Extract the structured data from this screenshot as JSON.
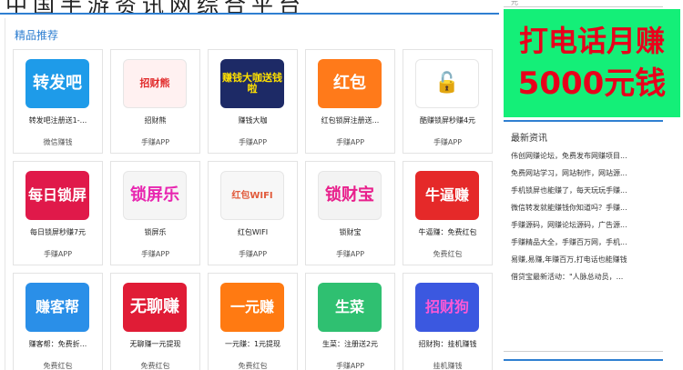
{
  "header": {
    "ghost_title": "中国手游资讯网综合平台"
  },
  "section": {
    "title": "精品推荐"
  },
  "apps": [
    {
      "name": "转发吧注册送1-...",
      "category": "微信赚钱",
      "thumb_text": "转发吧",
      "bg": "#1e9be9",
      "fg": "#ffffff",
      "fs": 18
    },
    {
      "name": "招财熊",
      "category": "手赚APP",
      "thumb_text": "招财熊",
      "bg": "#fff1f1",
      "fg": "#e12c2c",
      "fs": 11
    },
    {
      "name": "赚钱大咖",
      "category": "手赚APP",
      "thumb_text": "赚钱大咖送钱啦",
      "bg": "#1d2a66",
      "fg": "#ffe000",
      "fs": 11
    },
    {
      "name": "红包锁屏注册送...",
      "category": "手赚APP",
      "thumb_text": "红包",
      "bg": "#ff7a1a",
      "fg": "#ffffff",
      "fs": 18
    },
    {
      "name": "酷赚锁屏秒赚4元",
      "category": "手赚APP",
      "thumb_text": "🔓",
      "bg": "#ffffff",
      "fg": "#3ca8e8",
      "fs": 22
    },
    {
      "name": "每日锁屏秒赚7元",
      "category": "手赚APP",
      "thumb_text": "每日锁屏",
      "bg": "#e0194a",
      "fg": "#ffffff",
      "fs": 16
    },
    {
      "name": "锁屏乐",
      "category": "手赚APP",
      "thumb_text": "锁屏乐",
      "bg": "#f5f5f5",
      "fg": "#e826b0",
      "fs": 18
    },
    {
      "name": "红包WIFI",
      "category": "手赚APP",
      "thumb_text": "红包WIFI",
      "bg": "#f7f7f7",
      "fg": "#e15a3a",
      "fs": 10
    },
    {
      "name": "锁财宝",
      "category": "手赚APP",
      "thumb_text": "锁财宝",
      "bg": "#f3f3f3",
      "fg": "#e8208c",
      "fs": 18
    },
    {
      "name": "牛逼赚：免费红包",
      "category": "免费红包",
      "thumb_text": "牛逼赚",
      "bg": "#e52929",
      "fg": "#ffffff",
      "fs": 16
    },
    {
      "name": "赚客帮：免费折...",
      "category": "免费红包",
      "thumb_text": "赚客帮",
      "bg": "#2a8fe8",
      "fg": "#ffffff",
      "fs": 16
    },
    {
      "name": "无聊赚一元提现",
      "category": "免费红包",
      "thumb_text": "无聊赚",
      "bg": "#e01c36",
      "fg": "#ffffff",
      "fs": 18
    },
    {
      "name": "一元赚：1元提现",
      "category": "免费红包",
      "thumb_text": "一元赚",
      "bg": "#ff7a12",
      "fg": "#ffffff",
      "fs": 16
    },
    {
      "name": "生菜：注册送2元",
      "category": "手赚APP",
      "thumb_text": "生菜",
      "bg": "#2fc071",
      "fg": "#ffffff",
      "fs": 16
    },
    {
      "name": "招财狗：挂机赚钱",
      "category": "挂机赚钱",
      "thumb_text": "招财狗",
      "bg": "#3b58e0",
      "fg": "#ff58d6",
      "fs": 16
    }
  ],
  "sidebar": {
    "top_text": "元",
    "banner_line1": "打电话月赚",
    "banner_line2": "5000元钱",
    "news_title": "最新资讯",
    "news": [
      "伟创网赚论坛，免费发布网赚项目...",
      "免费网站学习，网站制作，网站源...",
      "手机锁屏也能赚了，每天玩玩手赚...",
      "微信转发就能赚钱你知道吗？手赚...",
      "手赚源码，网赚论坛源码，广告源...",
      "手赚精品大全，手赚百万网，手机...",
      "易赚,易赚,年赚百万,打电话也能赚钱",
      "借贷宝最新活动：\"人脉总动员，..."
    ]
  },
  "colors": {
    "accent": "#2f7fd1",
    "banner_bg": "#14ef78",
    "banner_text": "#e8001b"
  }
}
